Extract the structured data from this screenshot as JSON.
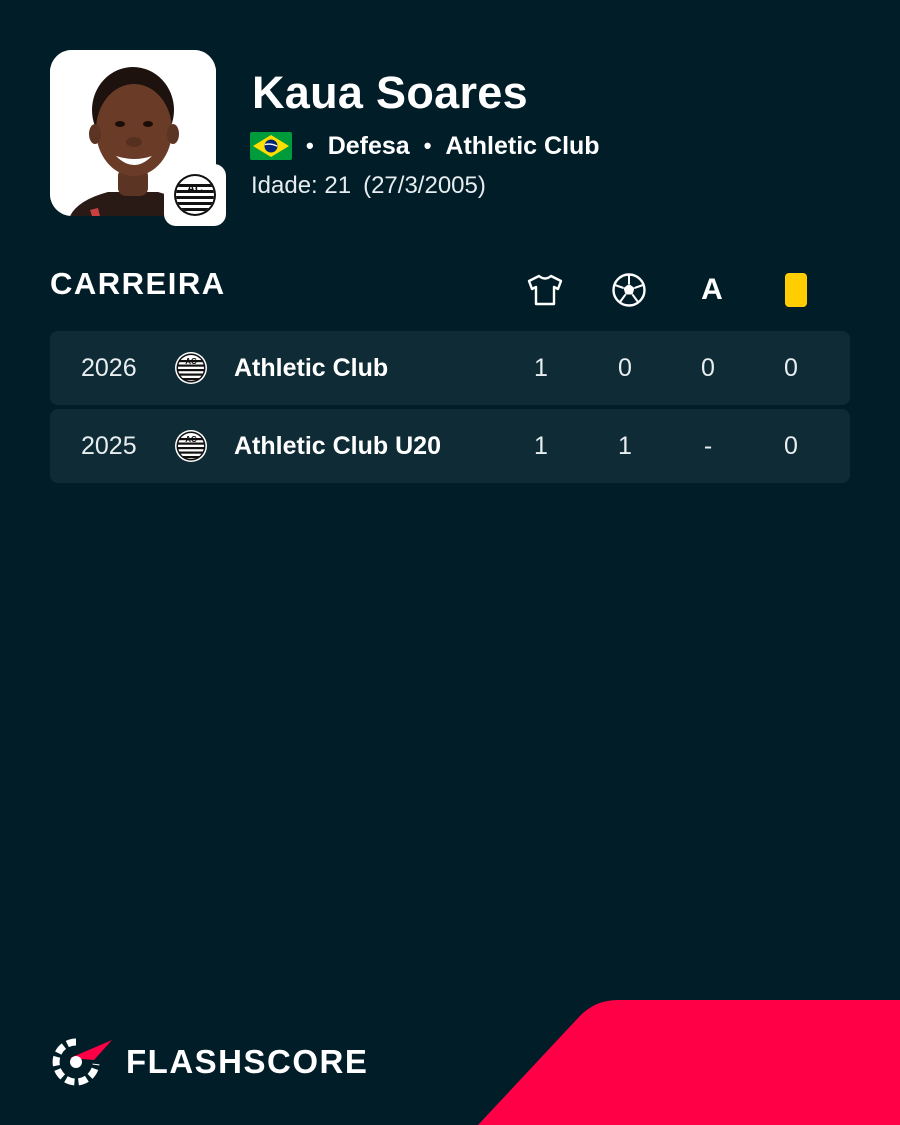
{
  "player": {
    "name": "Kaua Soares",
    "nationality_flag": "brazil-flag-icon",
    "position": "Defesa",
    "club": "Athletic Club",
    "age_label": "Idade: 21",
    "birth_date": "(27/3/2005)"
  },
  "career": {
    "title": "CARREIRA",
    "columns": [
      "jersey-icon",
      "ball-icon",
      "A",
      "yellow-card-icon"
    ],
    "rows": [
      {
        "year": "2026",
        "team": "Athletic Club",
        "apps": "1",
        "goals": "0",
        "assists": "0",
        "cards": "0"
      },
      {
        "year": "2025",
        "team": "Athletic Club U20",
        "apps": "1",
        "goals": "1",
        "assists": "-",
        "cards": "0"
      }
    ]
  },
  "brand": {
    "name": "FLASHSCORE"
  },
  "colors": {
    "background": "#011e28",
    "row": "#0f2b36",
    "accent": "#ff0046",
    "yellow_card": "#ffcd00"
  }
}
